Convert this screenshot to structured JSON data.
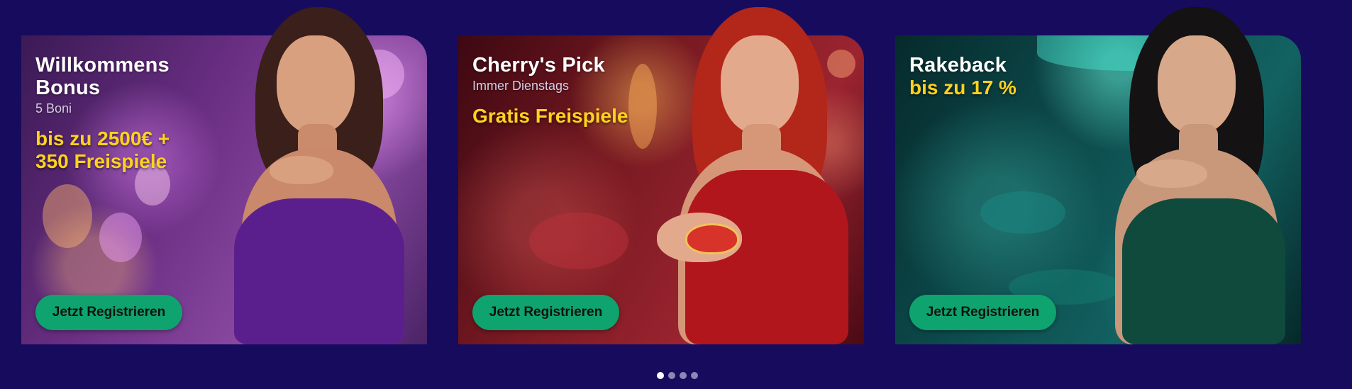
{
  "promotions": [
    {
      "title_line1": "Willkommens",
      "title_line2": "Bonus",
      "subtitle": "5 Boni",
      "offer_line1": "bis zu 2500€ +",
      "offer_line2": "350 Freispiele",
      "button_label": "Jetzt Registrieren"
    },
    {
      "title_line1": "Cherry's Pick",
      "subtitle": "Immer Dienstags",
      "offer_line1": "Gratis Freispiele",
      "button_label": "Jetzt Registrieren"
    },
    {
      "title_line1": "Rakeback",
      "offer_line1": "bis zu 17 %",
      "button_label": "Jetzt Registrieren"
    }
  ],
  "pagination": {
    "count": 4,
    "active_index": 0
  },
  "colors": {
    "page_background": "#170b5e",
    "button_background": "#0ea36f",
    "offer_text": "#ffd21f",
    "title_text": "#ffffff"
  }
}
